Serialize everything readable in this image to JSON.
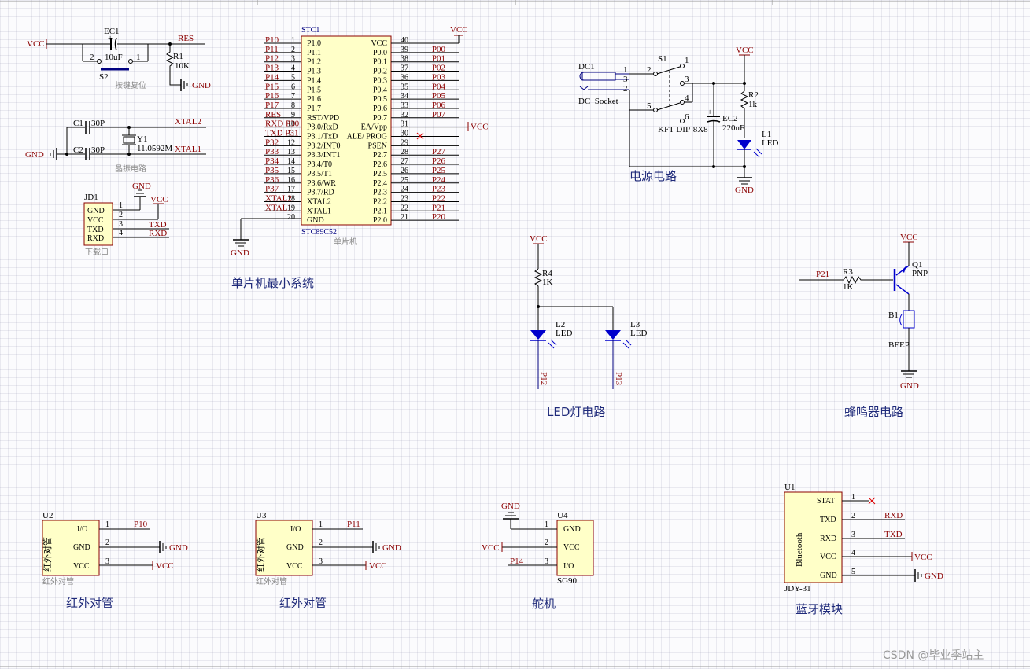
{
  "mcu": {
    "designator": "STC1",
    "part": "STC89C52",
    "comment": "单片机",
    "left_pins": [
      {
        "num": "1",
        "name": "P1.0",
        "net": "P10"
      },
      {
        "num": "2",
        "name": "P1.1",
        "net": "P11"
      },
      {
        "num": "3",
        "name": "P1.2",
        "net": "P12"
      },
      {
        "num": "4",
        "name": "P1.3",
        "net": "P13"
      },
      {
        "num": "5",
        "name": "P1.4",
        "net": "P14"
      },
      {
        "num": "6",
        "name": "P1.5",
        "net": "P15"
      },
      {
        "num": "7",
        "name": "P1.6",
        "net": "P16"
      },
      {
        "num": "8",
        "name": "P1.7",
        "net": "P17"
      },
      {
        "num": "9",
        "name": "RST/VPD",
        "net": "RES"
      },
      {
        "num": "10",
        "name": "P3.0/RxD",
        "net": "RXD P30"
      },
      {
        "num": "11",
        "name": "P3.1/TxD",
        "net": "TXD P31"
      },
      {
        "num": "12",
        "name": "P3.2/INT0",
        "net": "P32"
      },
      {
        "num": "13",
        "name": "P3.3/INT1",
        "net": "P33"
      },
      {
        "num": "14",
        "name": "P3.4/T0",
        "net": "P34"
      },
      {
        "num": "15",
        "name": "P3.5/T1",
        "net": "P35"
      },
      {
        "num": "16",
        "name": "P3.6/WR",
        "net": "P36"
      },
      {
        "num": "17",
        "name": "P3.7/RD",
        "net": "P37"
      },
      {
        "num": "18",
        "name": "XTAL2",
        "net": "XTAL2"
      },
      {
        "num": "19",
        "name": "XTAL1",
        "net": "XTAL1"
      },
      {
        "num": "20",
        "name": "GND",
        "net": ""
      }
    ],
    "right_pins": [
      {
        "num": "40",
        "name": "VCC",
        "net": ""
      },
      {
        "num": "39",
        "name": "P0.0",
        "net": "P00"
      },
      {
        "num": "38",
        "name": "P0.1",
        "net": "P01"
      },
      {
        "num": "37",
        "name": "P0.2",
        "net": "P02"
      },
      {
        "num": "36",
        "name": "P0.3",
        "net": "P03"
      },
      {
        "num": "35",
        "name": "P0.4",
        "net": "P04"
      },
      {
        "num": "34",
        "name": "P0.5",
        "net": "P05"
      },
      {
        "num": "33",
        "name": "P0.6",
        "net": "P06"
      },
      {
        "num": "32",
        "name": "P0.7",
        "net": "P07"
      },
      {
        "num": "31",
        "name": "EA/Vpp",
        "net": "VCC"
      },
      {
        "num": "30",
        "name": "ALE/ PROG",
        "net": ""
      },
      {
        "num": "29",
        "name": "PSEN",
        "net": ""
      },
      {
        "num": "28",
        "name": "P2.7",
        "net": "P27"
      },
      {
        "num": "27",
        "name": "P2.6",
        "net": "P26"
      },
      {
        "num": "26",
        "name": "P2.5",
        "net": "P25"
      },
      {
        "num": "25",
        "name": "P2.4",
        "net": "P24"
      },
      {
        "num": "24",
        "name": "P2.3",
        "net": "P23"
      },
      {
        "num": "23",
        "name": "P2.2",
        "net": "P22"
      },
      {
        "num": "22",
        "name": "P2.1",
        "net": "P21"
      },
      {
        "num": "21",
        "name": "P2.0",
        "net": "P20"
      }
    ],
    "vcc_label": "VCC",
    "gnd_label": "GND",
    "section_title": "单片机最小系统"
  },
  "reset": {
    "vcc": "VCC",
    "ec1": "EC1",
    "ec1_value": "10uF",
    "res_net": "RES",
    "r1": "R1",
    "r1_value": "10K",
    "s2": "S2",
    "pin2": "2",
    "pin1": "1",
    "gnd": "GND",
    "caption": "按键复位"
  },
  "crystal": {
    "c1": "C1",
    "c1_value": "30P",
    "c2": "C2",
    "c2_value": "30P",
    "y1": "Y1",
    "y1_value": "11.0592M",
    "xtal2": "XTAL2",
    "xtal1": "XTAL1",
    "gnd": "GND",
    "caption": "晶振电路"
  },
  "download": {
    "designator": "JD1",
    "pins": [
      {
        "num": "1",
        "name": "GND"
      },
      {
        "num": "2",
        "name": "VCC"
      },
      {
        "num": "3",
        "name": "TXD"
      },
      {
        "num": "4",
        "name": "RXD"
      }
    ],
    "gnd": "GND",
    "vcc": "VCC",
    "txd": "TXD",
    "rxd": "RXD",
    "caption": "下载口"
  },
  "power": {
    "dc1": "DC1",
    "dc_socket": "DC_Socket",
    "p1": "1",
    "p3": "3",
    "p2": "2",
    "s1": "S1",
    "s1_pins": [
      "2",
      "1",
      "3",
      "5",
      "4",
      "6"
    ],
    "s1_part": "KFT DIP-8X8",
    "ec2": "EC2",
    "ec2_value": "220uF",
    "r2": "R2",
    "r2_value": "1k",
    "l1": "L1",
    "l1_value": "LED",
    "vcc": "VCC",
    "gnd": "GND",
    "title": "电源电路"
  },
  "led": {
    "vcc": "VCC",
    "r4": "R4",
    "r4_value": "1K",
    "l2": "L2",
    "l2_value": "LED",
    "l3": "L3",
    "l3_value": "LED",
    "p12": "P12",
    "p13": "P13",
    "title": "LED灯电路"
  },
  "buzzer": {
    "vcc": "VCC",
    "p21": "P21",
    "r3": "R3",
    "r3_value": "1K",
    "q1": "Q1",
    "q1_value": "PNP",
    "b1": "B1",
    "b1_value": "BEEP",
    "gnd": "GND",
    "title": "蜂鸣器电路"
  },
  "ir1": {
    "designator": "U2",
    "pins": [
      {
        "num": "1",
        "name": "I/O",
        "net": "P10"
      },
      {
        "num": "2",
        "name": "GND",
        "net": "GND"
      },
      {
        "num": "3",
        "name": "VCC",
        "net": "VCC"
      }
    ],
    "body_text": "红外对管",
    "comment": "红外对管",
    "title": "红外对管"
  },
  "ir2": {
    "designator": "U3",
    "pins": [
      {
        "num": "1",
        "name": "I/O",
        "net": "P11"
      },
      {
        "num": "2",
        "name": "GND",
        "net": "GND"
      },
      {
        "num": "3",
        "name": "VCC",
        "net": "VCC"
      }
    ],
    "body_text": "红外对管",
    "comment": "红外对管",
    "title": "红外对管"
  },
  "servo": {
    "designator": "U4",
    "part": "SG90",
    "pins": [
      {
        "num": "1",
        "name": "GND",
        "net": "GND"
      },
      {
        "num": "2",
        "name": "VCC",
        "net": "VCC"
      },
      {
        "num": "3",
        "name": "I/O",
        "net": "P14"
      }
    ],
    "title": "舵机"
  },
  "bluetooth": {
    "designator": "U1",
    "part": "JDY-31",
    "body_text": "Bluetooth",
    "pins": [
      {
        "num": "1",
        "name": "STAT",
        "net": ""
      },
      {
        "num": "2",
        "name": "TXD",
        "net": "RXD"
      },
      {
        "num": "3",
        "name": "RXD",
        "net": "TXD"
      },
      {
        "num": "4",
        "name": "VCC",
        "net": "VCC"
      },
      {
        "num": "5",
        "name": "GND",
        "net": "GND"
      }
    ],
    "title": "蓝牙模块"
  },
  "watermark": "CSDN @毕业季站主",
  "colors": {
    "wire_blue": "#000080",
    "net_red": "#8b0000",
    "body_fill": "#ffffc8",
    "title_blue": "#1f2a7a"
  }
}
